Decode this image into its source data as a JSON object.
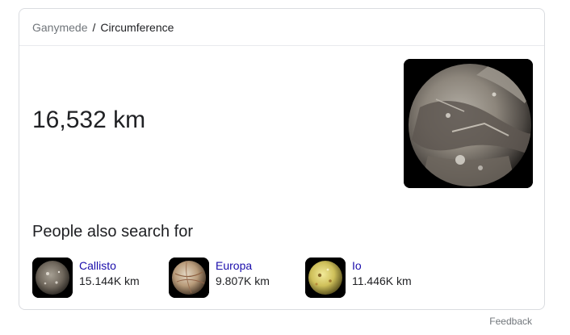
{
  "breadcrumb": {
    "parent": "Ganymede",
    "separator": "/",
    "current": "Circumference"
  },
  "answer": {
    "value": "16,532 km"
  },
  "hero_image": {
    "icon": "ganymede-moon-image"
  },
  "people_also_search": {
    "title": "People also search for",
    "items": [
      {
        "name": "Callisto",
        "value": "15.144K km",
        "icon": "callisto-moon-image"
      },
      {
        "name": "Europa",
        "value": "9.807K km",
        "icon": "europa-moon-image"
      },
      {
        "name": "Io",
        "value": "11.446K km",
        "icon": "io-moon-image"
      }
    ]
  },
  "footer": {
    "feedback_label": "Feedback"
  },
  "colors": {
    "link": "#1a0dab",
    "muted": "#70757a",
    "text": "#202124",
    "border": "#dadce0"
  }
}
